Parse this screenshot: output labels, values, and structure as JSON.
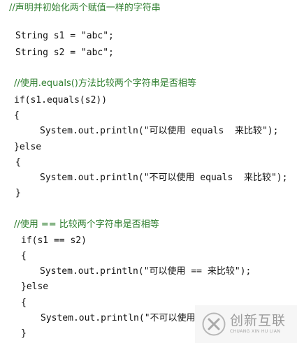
{
  "code": {
    "comment1": "//声明并初始化两个赋值一样的字符串",
    "line_s1": "String s1 = \"abc\";",
    "line_s2": "String s2 = \"abc\";",
    "comment2": "//使用.equals()方法比较两个字符串是否相等",
    "if1": "if(s1.equals(s2))",
    "brace_open1": "{",
    "print1": "System.out.println(\"可以使用 equals  来比较\");",
    "else1": "}else",
    "brace_open2": "{",
    "print2": "System.out.println(\"不可以使用 equals  来比较\");",
    "brace_close2": "}",
    "comment3": "//使用 == 比较两个字符串是否相等",
    "if2": "if(s1 == s2)",
    "brace_open3": "{",
    "print3": "System.out.println(\"可以使用 == 来比较\");",
    "else2": "}else",
    "brace_open4": "{",
    "print4": "System.out.println(\"不可以使用",
    "brace_close4": "}"
  },
  "watermark": {
    "main": "创新互联",
    "sub": "CHUANG XIN HU LIAN",
    "icon": "logo-x-icon"
  },
  "colors": {
    "comment": "#2f7f2f",
    "code": "#111111",
    "watermark": "#9a9a9a"
  }
}
